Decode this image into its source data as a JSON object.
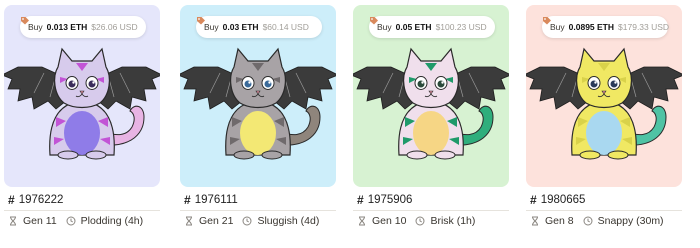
{
  "cards": [
    {
      "price": {
        "buy_label": "Buy",
        "eth": "0.013 ETH",
        "usd": "$26.06 USD"
      },
      "id": "1976222",
      "gen": "Gen 11",
      "speed": "Plodding (4h)",
      "colors": {
        "bg": "#e5e6fb",
        "body": "#d7cbec",
        "stripe": "#c254d6",
        "belly": "#8f7ce8",
        "tail": "#e8b4e4",
        "eye": "#3a2c5a"
      }
    },
    {
      "price": {
        "buy_label": "Buy",
        "eth": "0.03 ETH",
        "usd": "$60.14 USD"
      },
      "id": "1976111",
      "gen": "Gen 21",
      "speed": "Sluggish (4d)",
      "colors": {
        "bg": "#cdeefa",
        "body": "#a8a3a6",
        "stripe": "#6f6a6c",
        "belly": "#f3e874",
        "tail": "#8f857c",
        "eye": "#3a6a9a"
      }
    },
    {
      "price": {
        "buy_label": "Buy",
        "eth": "0.05 ETH",
        "usd": "$100.23 USD"
      },
      "id": "1975906",
      "gen": "Gen 10",
      "speed": "Brisk (1h)",
      "colors": {
        "bg": "#d7f2d2",
        "body": "#f0dfec",
        "stripe": "#1f9a6a",
        "belly": "#f6d685",
        "tail": "#2fae7c",
        "eye": "#2a4a3a"
      }
    },
    {
      "price": {
        "buy_label": "Buy",
        "eth": "0.0895 ETH",
        "usd": "$179.33 USD"
      },
      "id": "1980665",
      "gen": "Gen 8",
      "speed": "Snappy (30m)",
      "colors": {
        "bg": "#fde2dc",
        "body": "#f0e863",
        "stripe": "#d9d24a",
        "belly": "#a9d8f0",
        "tail": "#4fc3a4",
        "eye": "#2a3a5a"
      }
    }
  ]
}
